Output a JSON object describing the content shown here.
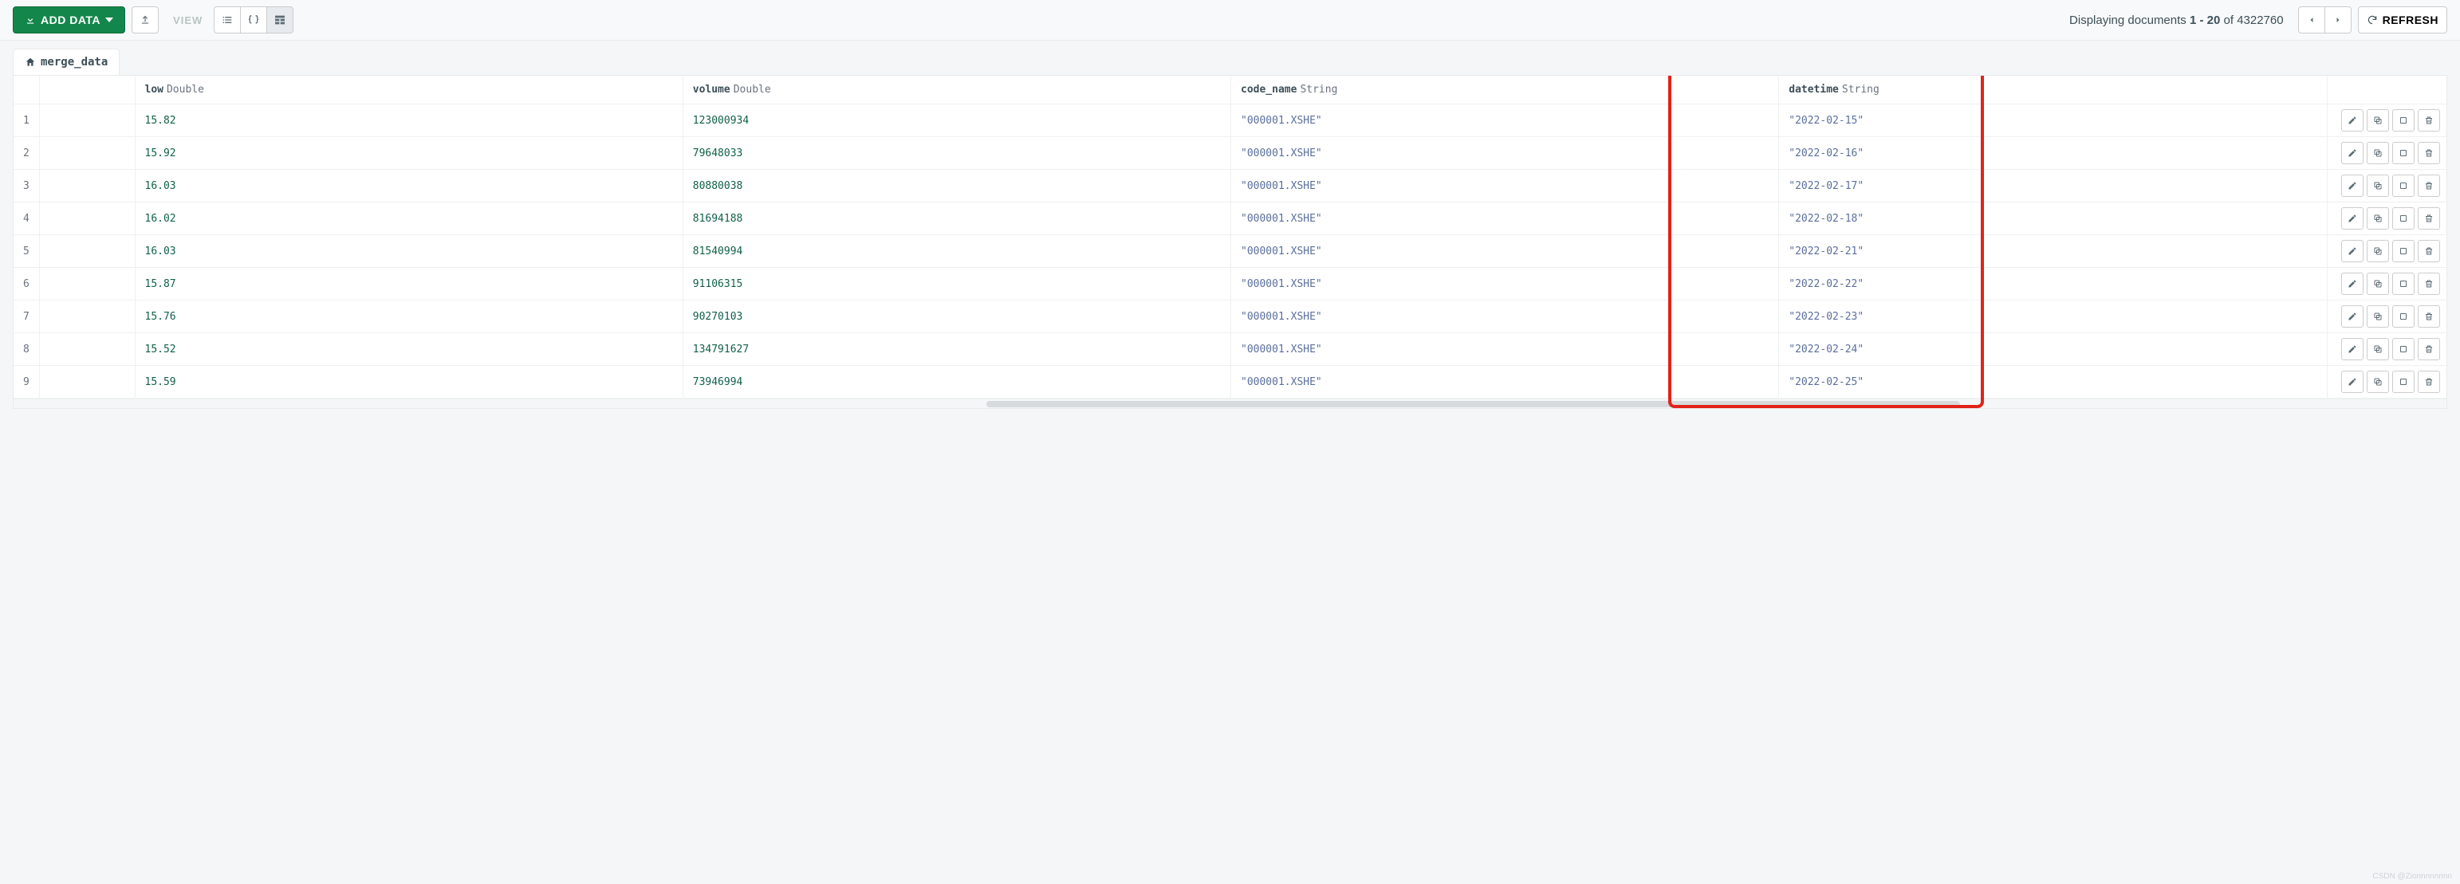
{
  "toolbar": {
    "add_data_label": "ADD DATA",
    "view_label": "VIEW",
    "doc_count_prefix": "Displaying documents ",
    "doc_count_range": "1 - 20",
    "doc_count_mid": " of ",
    "doc_count_total": "4322760",
    "refresh_label": "REFRESH"
  },
  "tab": {
    "name": "merge_data"
  },
  "columns": [
    {
      "name": "low",
      "type": "Double"
    },
    {
      "name": "volume",
      "type": "Double"
    },
    {
      "name": "code_name",
      "type": "String"
    },
    {
      "name": "datetime",
      "type": "String"
    }
  ],
  "rows": [
    {
      "n": "1",
      "low": "15.82",
      "volume": "123000934",
      "code_name": "\"000001.XSHE\"",
      "datetime": "\"2022-02-15\""
    },
    {
      "n": "2",
      "low": "15.92",
      "volume": "79648033",
      "code_name": "\"000001.XSHE\"",
      "datetime": "\"2022-02-16\""
    },
    {
      "n": "3",
      "low": "16.03",
      "volume": "80880038",
      "code_name": "\"000001.XSHE\"",
      "datetime": "\"2022-02-17\""
    },
    {
      "n": "4",
      "low": "16.02",
      "volume": "81694188",
      "code_name": "\"000001.XSHE\"",
      "datetime": "\"2022-02-18\""
    },
    {
      "n": "5",
      "low": "16.03",
      "volume": "81540994",
      "code_name": "\"000001.XSHE\"",
      "datetime": "\"2022-02-21\""
    },
    {
      "n": "6",
      "low": "15.87",
      "volume": "91106315",
      "code_name": "\"000001.XSHE\"",
      "datetime": "\"2022-02-22\""
    },
    {
      "n": "7",
      "low": "15.76",
      "volume": "90270103",
      "code_name": "\"000001.XSHE\"",
      "datetime": "\"2022-02-23\""
    },
    {
      "n": "8",
      "low": "15.52",
      "volume": "134791627",
      "code_name": "\"000001.XSHE\"",
      "datetime": "\"2022-02-24\""
    },
    {
      "n": "9",
      "low": "15.59",
      "volume": "73946994",
      "code_name": "\"000001.XSHE\"",
      "datetime": "\"2022-02-25\""
    }
  ],
  "watermark": "CSDN @Zionnnnnnnn"
}
